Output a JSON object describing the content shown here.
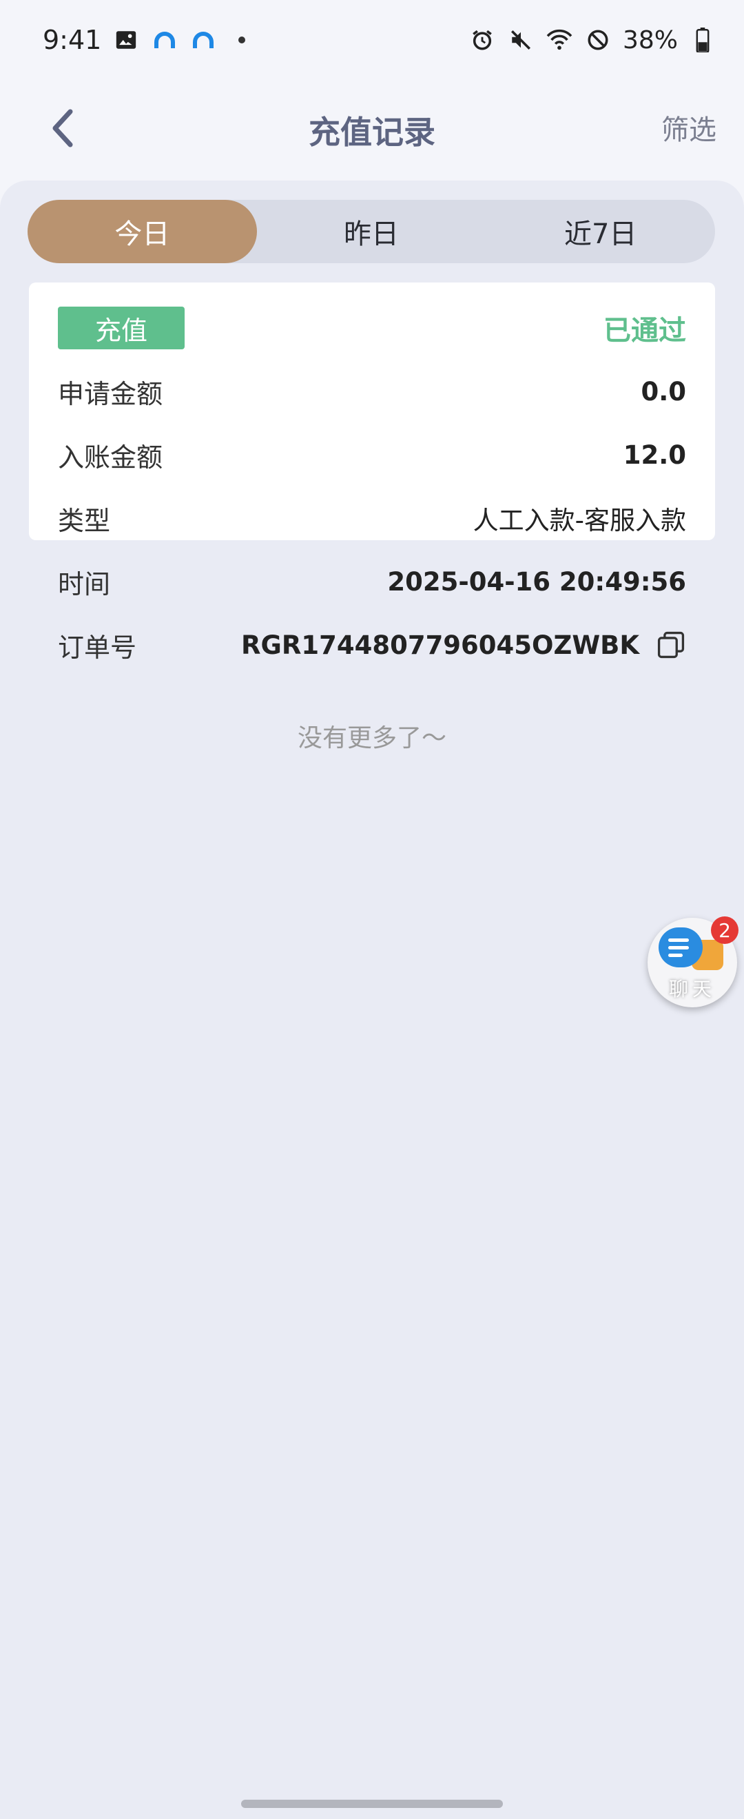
{
  "status_bar": {
    "time": "9:41",
    "battery": "38%",
    "icons_left": [
      "image-icon",
      "notification-icon",
      "notification-icon",
      "dot"
    ],
    "icons_right": [
      "alarm-icon",
      "mute-icon",
      "wifi-icon",
      "dnd-icon",
      "battery-icon"
    ]
  },
  "header": {
    "title": "充值记录",
    "filter_label": "筛选"
  },
  "tabs": [
    {
      "label": "今日",
      "active": true
    },
    {
      "label": "昨日",
      "active": false
    },
    {
      "label": "近7日",
      "active": false
    }
  ],
  "record": {
    "type_badge": "充值",
    "status": "已通过",
    "rows": [
      {
        "label": "申请金额",
        "value": "0.0"
      },
      {
        "label": "入账金额",
        "value": "12.0"
      },
      {
        "label": "类型",
        "value": "人工入款-客服入款"
      },
      {
        "label": "时间",
        "value": "2025-04-16 20:49:56"
      },
      {
        "label": "订单号",
        "value": "RGR1744807796045OZWBK"
      }
    ]
  },
  "no_more_text": "没有更多了～",
  "chat": {
    "label": "聊天",
    "badge": "2"
  },
  "colors": {
    "accent": "#b99370",
    "success": "#5fbf8d",
    "title": "#5d6481"
  }
}
